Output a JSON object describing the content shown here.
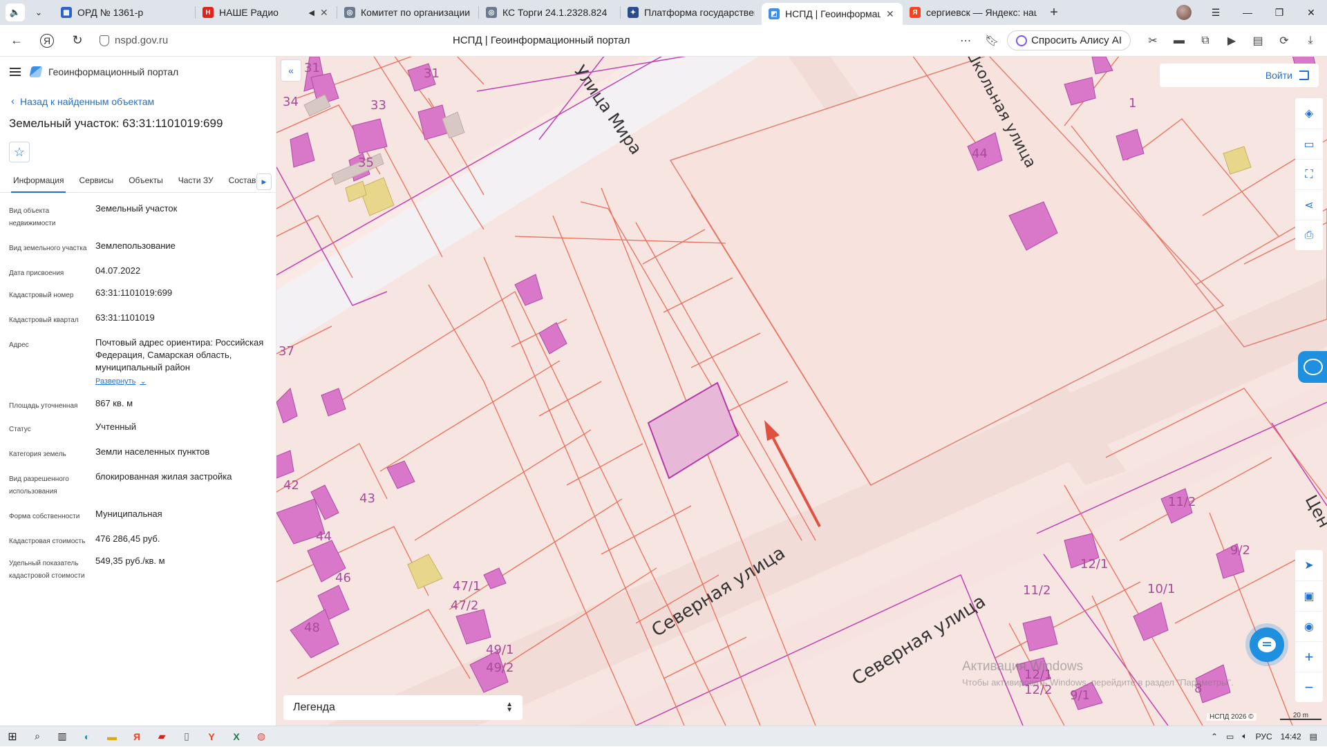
{
  "browser": {
    "tabs": [
      {
        "title": "ОРД № 1361-р",
        "favicon_color": "#2a62c9",
        "favicon_glyph": "▦",
        "active": false
      },
      {
        "title": "НАШЕ Радио",
        "favicon_color": "#e2231a",
        "favicon_glyph": "Н",
        "active": false,
        "audio": true
      },
      {
        "title": "Комитет по организации",
        "favicon_color": "#6b7a8f",
        "favicon_glyph": "◎",
        "active": false
      },
      {
        "title": "КС Торги 24.1.2328.824",
        "favicon_color": "#6b7a8f",
        "favicon_glyph": "◎",
        "active": false
      },
      {
        "title": "Платформа государствен",
        "favicon_color": "#2b4c8c",
        "favicon_glyph": "✦",
        "active": false
      },
      {
        "title": "НСПД | Геоинформаци",
        "favicon_color": "#3a8fe8",
        "favicon_glyph": "◩",
        "active": true
      },
      {
        "title": "сергиевск — Яндекс: наш",
        "favicon_color": "#fc3f1d",
        "favicon_glyph": "Я",
        "active": false
      }
    ],
    "url": "nspd.gov.ru",
    "page_title": "НСПД | Геоинформационный портал",
    "alice_label": "Спросить Алису AI"
  },
  "panel": {
    "portal_name": "Геоинформационный портал",
    "back_label": "Назад к найденным объектам",
    "object_title": "Земельный участок: 63:31:1101019:699",
    "tabs": [
      "Информация",
      "Сервисы",
      "Объекты",
      "Части ЗУ",
      "Состав"
    ],
    "active_tab": 0,
    "properties": [
      {
        "label": "Вид объекта недвижимости",
        "value": "Земельный участок"
      },
      {
        "label": "Вид земельного участка",
        "value": "Землепользование"
      },
      {
        "label": "Дата присвоения",
        "value": "04.07.2022"
      },
      {
        "label": "Кадастровый номер",
        "value": "63:31:1101019:699"
      },
      {
        "label": "Кадастровый квартал",
        "value": "63:31:1101019"
      },
      {
        "label": "Адрес",
        "value": "Почтовый адрес ориентира: Российская Федерация, Самарская область, муниципальный район",
        "expand": "Развернуть"
      },
      {
        "label": "Площадь уточненная",
        "value": "867 кв. м"
      },
      {
        "label": "Статус",
        "value": "Учтенный"
      },
      {
        "label": "Категория земель",
        "value": "Земли населенных пунктов"
      },
      {
        "label": "Вид разрешенного использования",
        "value": "блокированная жилая застройка"
      },
      {
        "label": "Форма собственности",
        "value": "Муниципальная"
      },
      {
        "label": "Кадастровая стоимость",
        "value": "476 286,45 руб."
      },
      {
        "label": "Удельный показатель кадастровой стоимости",
        "value": "549,35 руб./кв. м"
      }
    ]
  },
  "map": {
    "login_label": "Войти",
    "legend_label": "Легенда",
    "streets": [
      "Улица Мира",
      "Школьная улица",
      "Северная улица",
      "Северная улица",
      "Цен"
    ],
    "house_numbers": [
      "31",
      "31",
      "33",
      "34",
      "35",
      "37",
      "1",
      "44",
      "42",
      "43",
      "44",
      "46",
      "48",
      "47/1",
      "47/2",
      "49/1",
      "49/2",
      "11/2",
      "9/2",
      "12/1",
      "10/1",
      "11/2",
      "12/1",
      "12/2",
      "9/1",
      "8"
    ],
    "copyright": "НСПД 2026 ©",
    "scale_label": "20 m",
    "watermark_title": "Активация Windows",
    "watermark_text": "Чтобы активировать Windows, перейдите в раздел \"Параметры\"."
  },
  "taskbar": {
    "language": "РУС",
    "time": "14:42"
  }
}
